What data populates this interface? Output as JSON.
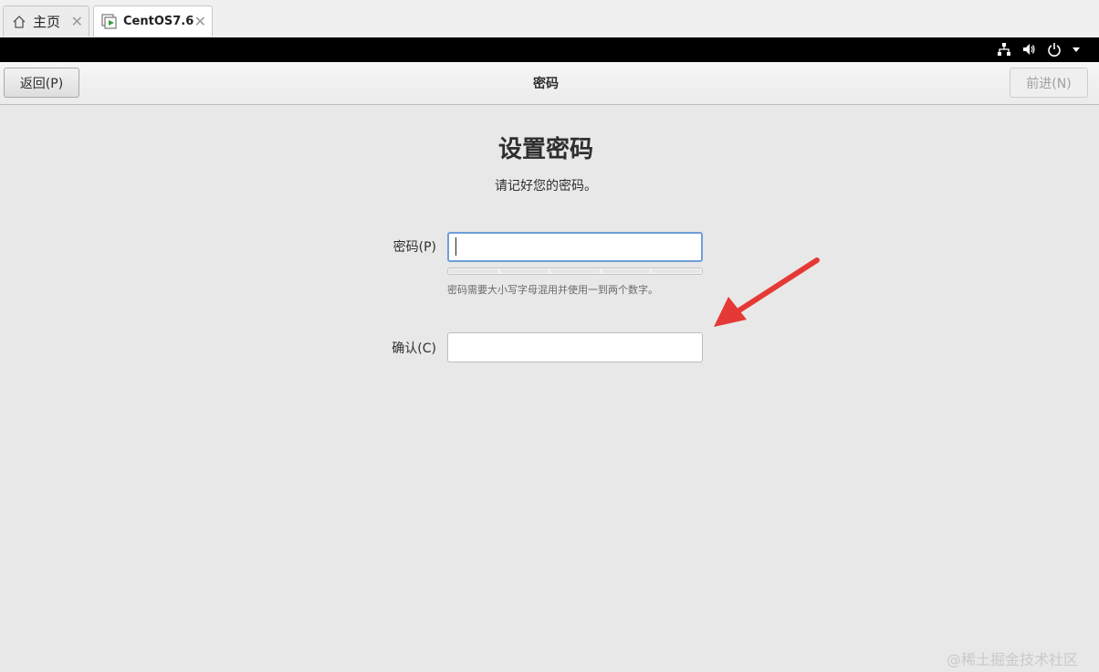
{
  "tabs": [
    {
      "label": "主页",
      "icon": "home-icon"
    },
    {
      "label": "CentOS7.6",
      "icon": "vm-play-icon"
    }
  ],
  "system_tray": {
    "icons": [
      "network-icon",
      "volume-icon",
      "power-icon",
      "dropdown-arrow-icon"
    ]
  },
  "header": {
    "back_label": "返回(P)",
    "title": "密码",
    "next_label": "前进(N)"
  },
  "main": {
    "title": "设置密码",
    "subtitle": "请记好您的密码。",
    "password": {
      "label": "密码(P)",
      "value": "",
      "hint": "密码需要大小写字母混用并使用一到两个数字。",
      "strength_level": 0
    },
    "confirm": {
      "label": "确认(C)",
      "value": ""
    }
  },
  "watermark": "@稀土掘金技术社区",
  "colors": {
    "accent_border": "#6f9ed8",
    "annotation_arrow": "#e53935",
    "top_bar": "#000000"
  }
}
